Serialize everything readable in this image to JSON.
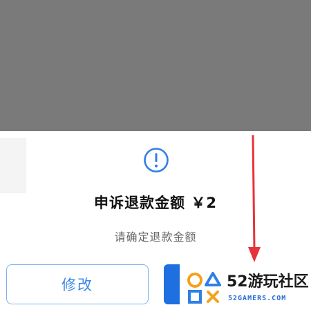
{
  "dialog": {
    "title": "申诉退款金额 ￥2",
    "subtitle": "请确定退款金额",
    "modify_label": "修改",
    "confirm_label": "",
    "icon": "exclamation-circle-icon",
    "accent_color": "#1e6fe0"
  },
  "watermark": {
    "brand": "52游玩社区",
    "site": "52GAMERS.COM"
  }
}
